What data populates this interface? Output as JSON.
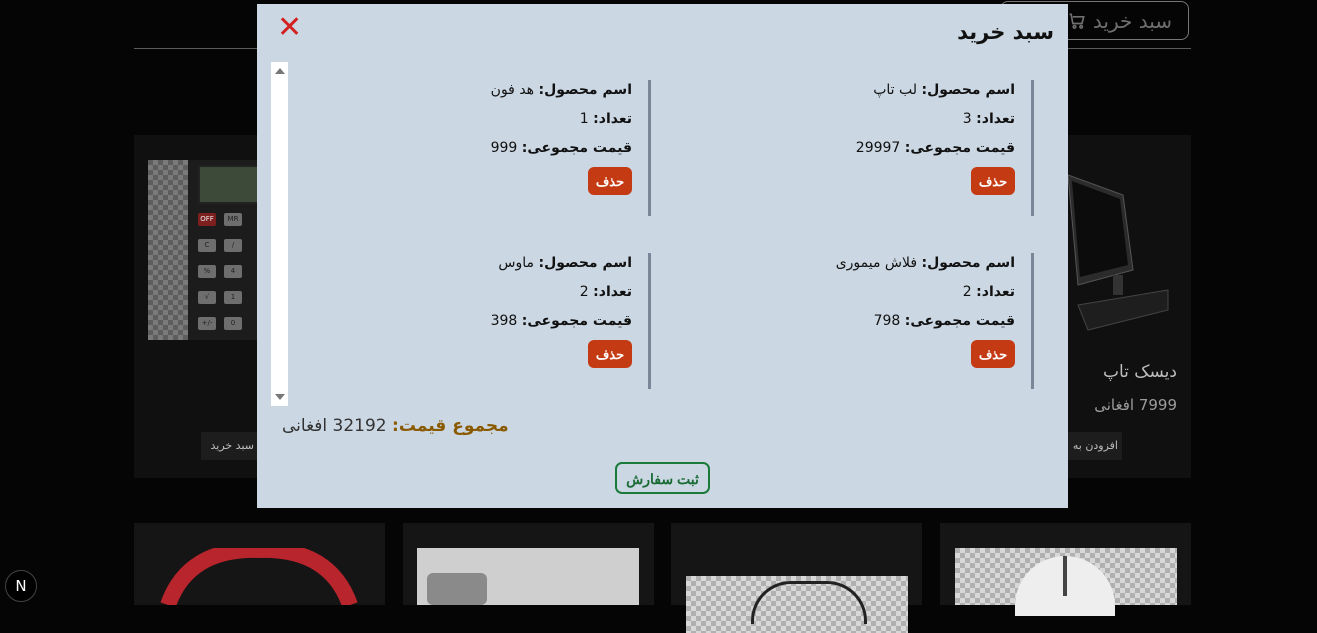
{
  "header": {
    "cart_button_label": "سبد خرید"
  },
  "background": {
    "desktop_name": "دیسک تاپ",
    "desktop_price": "7999 افغانی",
    "add_to_cart_partial_right": "افزودن به",
    "add_to_cart_partial_left": "سبد خرید",
    "calc_keys": [
      "OFF",
      "MR",
      "C",
      "%",
      "√",
      "+/-",
      "/",
      "4",
      "1",
      "0"
    ]
  },
  "modal": {
    "title": "سبد خرید",
    "close_symbol": "✕",
    "items": [
      {
        "name_label": "اسم محصول:",
        "name": "لب تاپ",
        "qty_label": "تعداد:",
        "qty": "3",
        "total_label": "قیمت مجموعی:",
        "total": "29997",
        "delete_label": "حذف"
      },
      {
        "name_label": "اسم محصول:",
        "name": "هد فون",
        "qty_label": "تعداد:",
        "qty": "1",
        "total_label": "قیمت مجموعی:",
        "total": "999",
        "delete_label": "حذف"
      },
      {
        "name_label": "اسم محصول:",
        "name": "فلاش میموری",
        "qty_label": "تعداد:",
        "qty": "2",
        "total_label": "قیمت مجموعی:",
        "total": "798",
        "delete_label": "حذف"
      },
      {
        "name_label": "اسم محصول:",
        "name": "ماوس",
        "qty_label": "تعداد:",
        "qty": "2",
        "total_label": "قیمت مجموعی:",
        "total": "398",
        "delete_label": "حذف"
      }
    ],
    "sum_label": "مجموع قیمت:",
    "sum_value": "32192 افغانی",
    "order_button": "ثبت سفارش"
  },
  "colors": {
    "modal_bg": "#cbd7e3",
    "delete_bg": "#c43a12",
    "close": "#d32020",
    "order_border": "#1a7a3a",
    "sum_label": "#8a5a00"
  },
  "next_badge": "N"
}
